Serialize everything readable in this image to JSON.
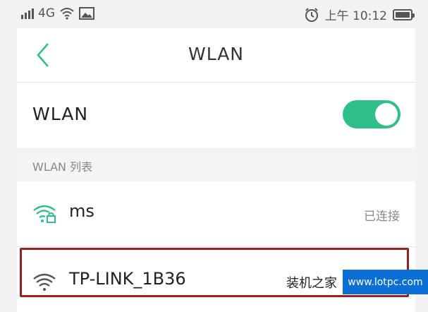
{
  "status_bar": {
    "network": "4G",
    "time": "上午 10:12",
    "icons": [
      "signal-icon",
      "wifi-icon",
      "image-icon",
      "alarm-icon",
      "battery-icon"
    ]
  },
  "header": {
    "title": "WLAN",
    "back_icon": "chevron-left-icon"
  },
  "wlan_toggle": {
    "label": "WLAN",
    "enabled": true,
    "color": "#2fbf8a"
  },
  "section": {
    "label": "WLAN 列表"
  },
  "networks": [
    {
      "ssid": "ms",
      "status": "已连接",
      "secured": true,
      "icon_color": "#2fbf8a"
    },
    {
      "ssid": "TP-LINK_1B36",
      "status": "",
      "secured": false,
      "icon_color": "#555555"
    }
  ],
  "highlight_color": "#9a1f1f",
  "watermark": {
    "text": "装机之家",
    "url": "www.lotpc.com"
  }
}
